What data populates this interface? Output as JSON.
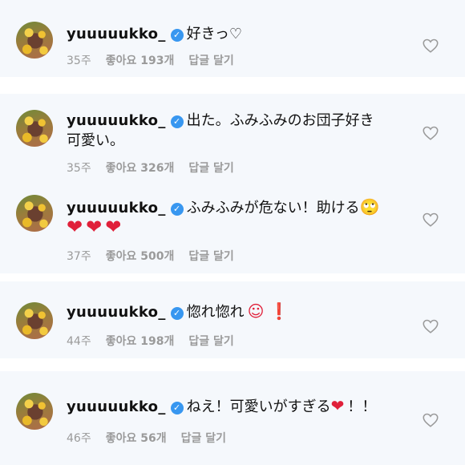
{
  "comments": [
    {
      "username": "yuuuuukko_",
      "text": "好きっ♡",
      "text2": "",
      "time": "35주",
      "likes": "좋아요 193개",
      "reply": "답글 달기"
    },
    {
      "username": "yuuuuukko_",
      "text": "出た。ふみふみのお団子好き",
      "text2": "可愛い。",
      "time": "35주",
      "likes": "좋아요 326개",
      "reply": "답글 달기"
    },
    {
      "username": "yuuuuukko_",
      "text": "ふみふみが危ない！助ける",
      "text2": "",
      "emoji_after": "🙄",
      "hearts_line": "❤❤❤",
      "time": "37주",
      "likes": "좋아요 500개",
      "reply": "답글 달기"
    },
    {
      "username": "yuuuuukko_",
      "text": "惚れ惚れ",
      "text2": "",
      "emoji_after": "☺ ❗",
      "time": "44주",
      "likes": "좋아요 198개",
      "reply": "답글 달기"
    },
    {
      "username": "yuuuuukko_",
      "text": "ねえ！可愛いがすぎる",
      "text2": "",
      "emoji_after": "❤",
      "text_tail": "！！",
      "time": "46주",
      "likes": "좋아요 56개",
      "reply": "답글 달기"
    }
  ],
  "icons": {
    "verified": "verified-badge-icon",
    "like": "heart-outline-icon"
  },
  "colors": {
    "card_bg": "#f5f8fc",
    "badge": "#3897f0",
    "meta": "#9a9a9a",
    "red_heart": "#e0203a"
  }
}
